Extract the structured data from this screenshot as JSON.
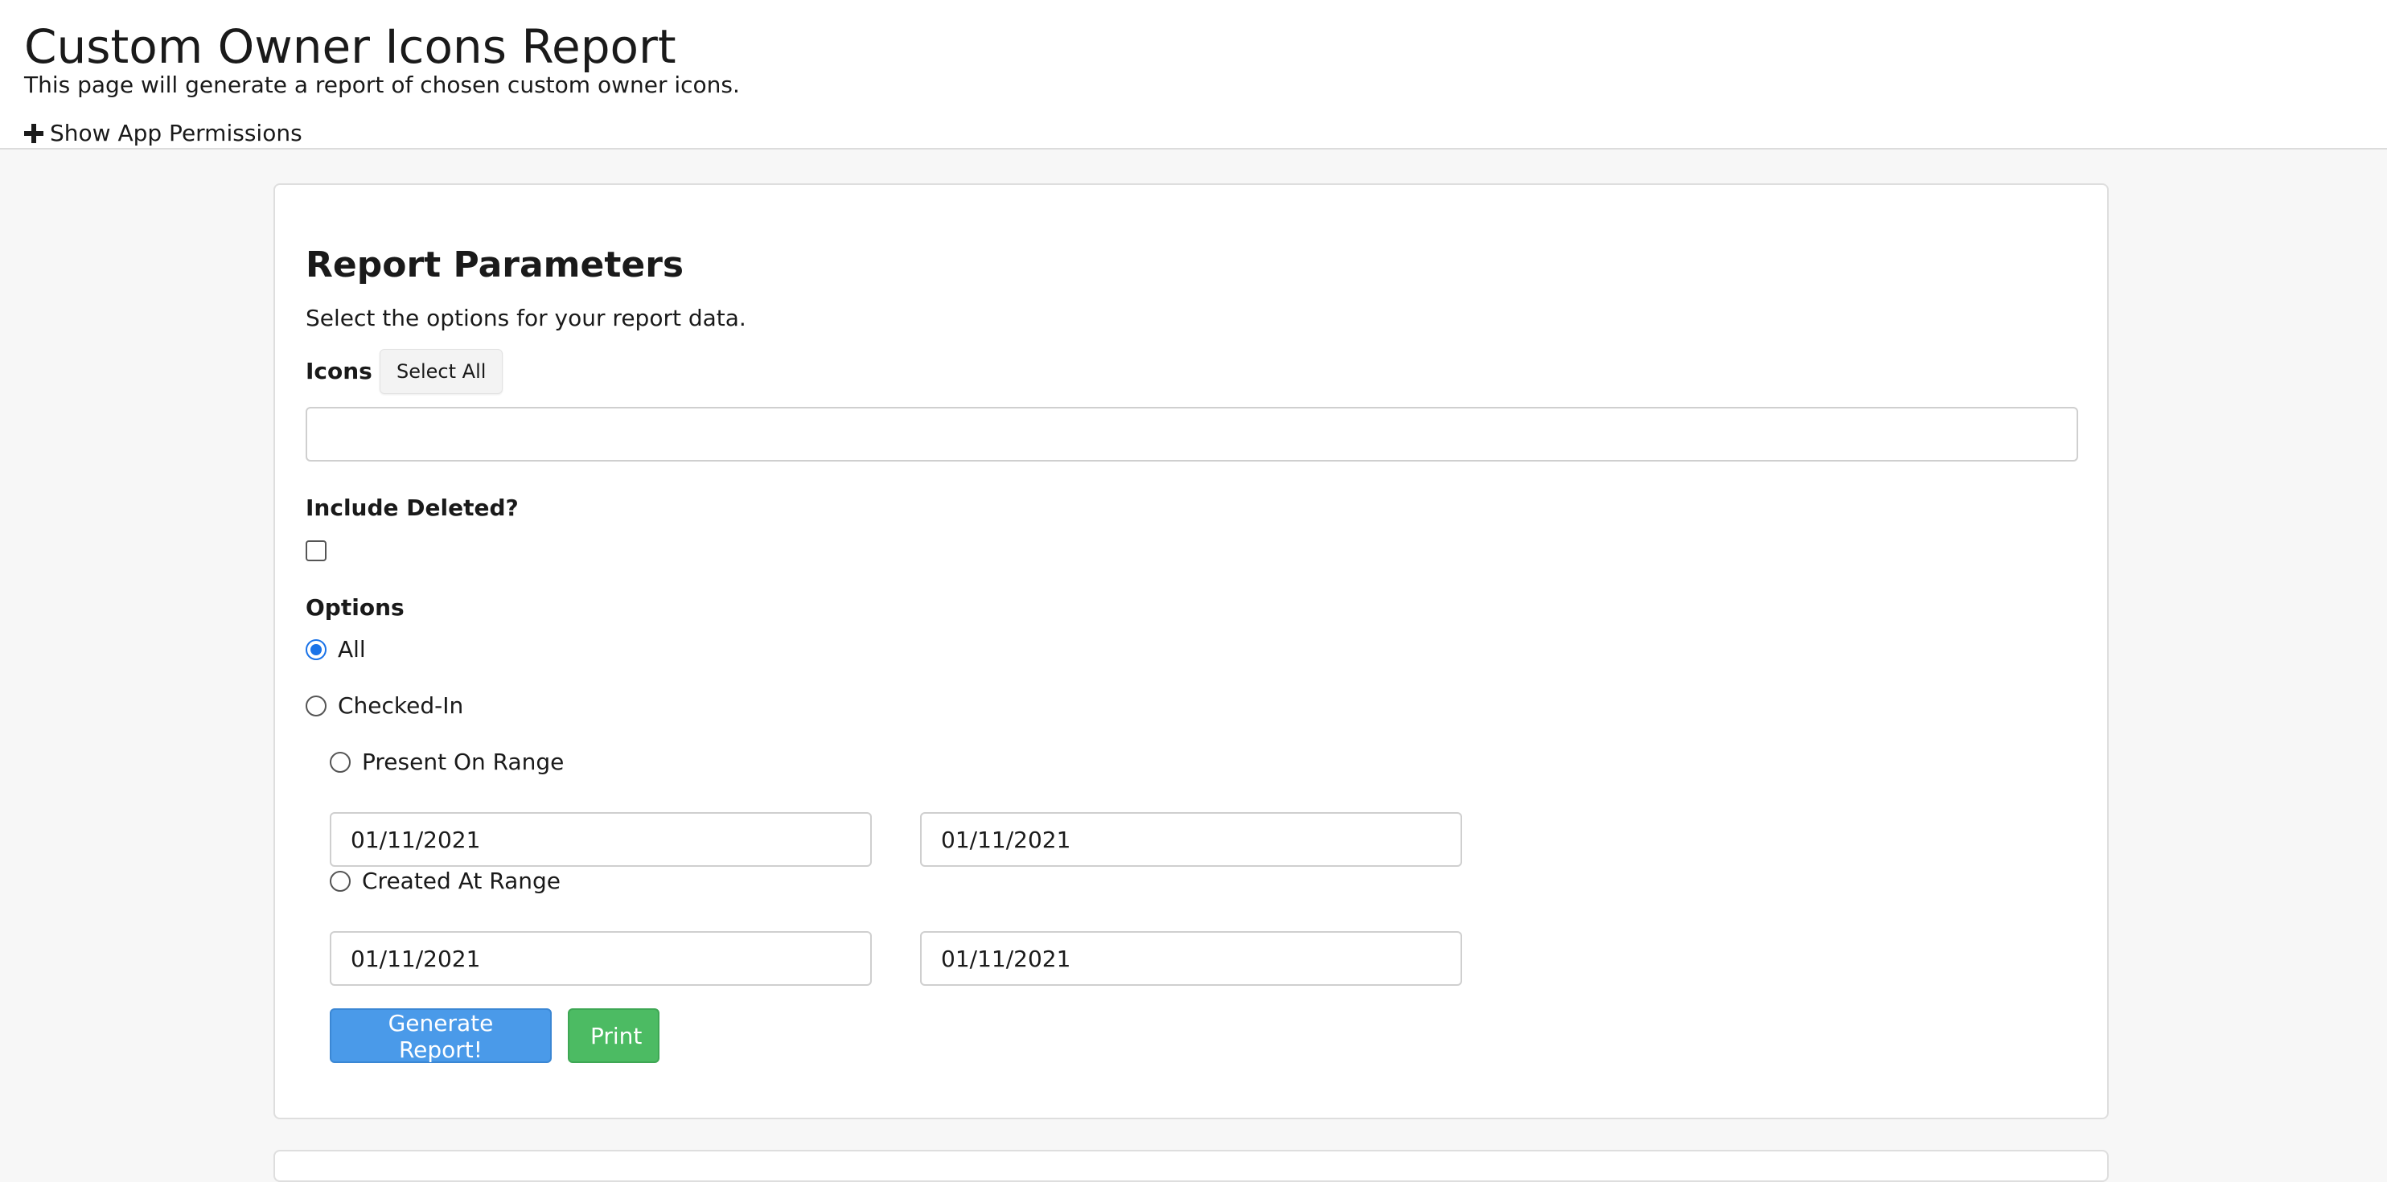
{
  "header": {
    "title": "Custom Owner Icons Report",
    "subtitle": "This page will generate a report of chosen custom owner icons.",
    "permissions_toggle": "Show App Permissions"
  },
  "report": {
    "title": "Report Parameters",
    "description": "Select the options for your report data.",
    "icons_label": "Icons",
    "select_all_label": "Select All",
    "icons_value": "",
    "include_deleted_label": "Include Deleted?",
    "include_deleted_checked": false,
    "options_label": "Options",
    "options": {
      "all_label": "All",
      "checked_in_label": "Checked-In",
      "present_on_range_label": "Present On Range",
      "created_at_range_label": "Created At Range",
      "selected": "All"
    },
    "present_on_range": {
      "start": "01/11/2021",
      "end": "01/11/2021"
    },
    "created_at_range": {
      "start": "01/11/2021",
      "end": "01/11/2021"
    },
    "generate_label": "Generate Report!",
    "print_label": "Print"
  },
  "colors": {
    "primary": "#4a9ae9",
    "success": "#4cbb63",
    "radio_checked": "#1a73e8"
  }
}
